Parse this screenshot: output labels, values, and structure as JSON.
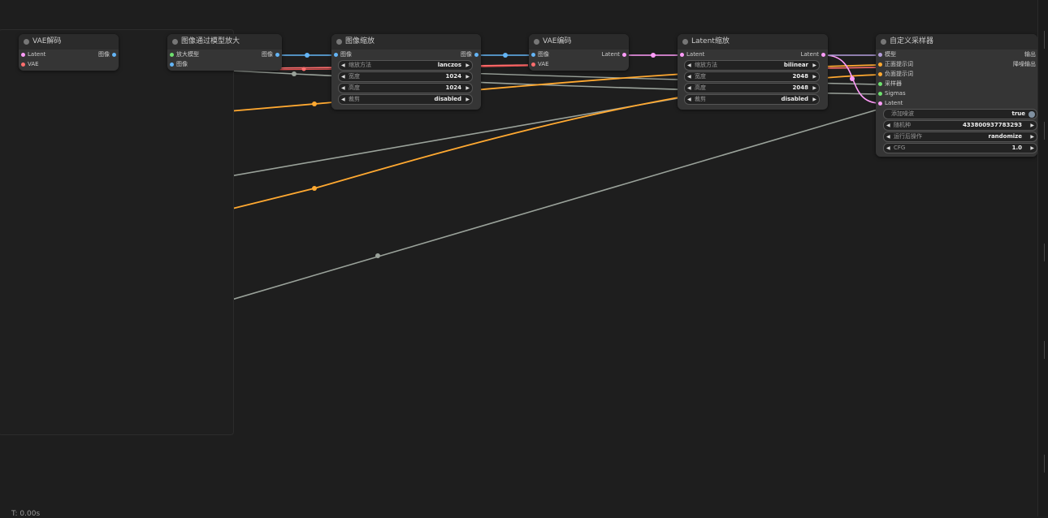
{
  "nodes": {
    "vae_decode": {
      "title": "VAE解码",
      "inputs": [
        "Latent",
        "VAE"
      ],
      "outputs": [
        "图像"
      ]
    },
    "upscale_model": {
      "title": "图像通过模型放大",
      "inputs": [
        "放大模型",
        "图像"
      ],
      "outputs": [
        "图像"
      ]
    },
    "image_scale": {
      "title": "图像缩放",
      "inputs": [
        "图像"
      ],
      "outputs": [
        "图像"
      ],
      "widgets": [
        {
          "label": "缩放方法",
          "value": "lanczos"
        },
        {
          "label": "宽度",
          "value": "1024"
        },
        {
          "label": "高度",
          "value": "1024"
        },
        {
          "label": "裁剪",
          "value": "disabled"
        }
      ]
    },
    "vae_encode": {
      "title": "VAE编码",
      "inputs": [
        "图像",
        "VAE"
      ],
      "outputs": [
        "Latent"
      ]
    },
    "latent_scale": {
      "title": "Latent缩放",
      "inputs": [
        "Latent"
      ],
      "outputs": [
        "Latent"
      ],
      "widgets": [
        {
          "label": "缩放方法",
          "value": "bilinear"
        },
        {
          "label": "宽度",
          "value": "2048"
        },
        {
          "label": "高度",
          "value": "2048"
        },
        {
          "label": "裁剪",
          "value": "disabled"
        }
      ]
    },
    "custom_sampler": {
      "title": "自定义采样器",
      "inputs": [
        "模型",
        "正面提示词",
        "负面提示词",
        "采样器",
        "Sigmas",
        "Latent"
      ],
      "outputs": [
        "输出",
        "降噪输出"
      ],
      "widgets": [
        {
          "label": "添加噪波",
          "value": "true"
        },
        {
          "label": "随机种",
          "value": "433800937783293"
        },
        {
          "label": "运行后操作",
          "value": "randomize"
        },
        {
          "label": "CFG",
          "value": "1.0"
        }
      ]
    }
  },
  "status": {
    "time": "T: 0.00s"
  },
  "colors": {
    "canvas": "#1e1e1e",
    "node_body": "#353535",
    "node_title": "#2b2b2b",
    "latent": "#ff9cf9",
    "vae": "#ff6e6e",
    "image": "#64b5f6",
    "upscale_model": "#6ee06e",
    "conditioning": "#ffa931",
    "sampler_sigma": "#b0b0b0",
    "model": "#b39ddb"
  }
}
